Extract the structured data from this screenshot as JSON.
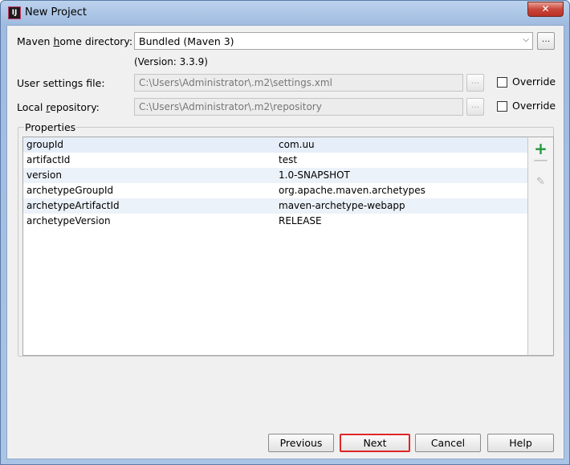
{
  "window": {
    "title": "New Project",
    "app_icon": "intellij-idea-icon",
    "app_icon_text": "IJ",
    "close_glyph": "✕"
  },
  "maven_home": {
    "label_pre": "Maven ",
    "label_mnemonic": "h",
    "label_post": "ome directory:",
    "value": "Bundled (Maven 3)",
    "version_text": "(Version: 3.3.9)",
    "browse_label": "..."
  },
  "user_settings": {
    "label": "User settings file:",
    "value": "C:\\Users\\Administrator\\.m2\\settings.xml",
    "browse_label": "...",
    "override_label": "Override",
    "override_checked": false
  },
  "local_repo": {
    "label_pre": "Local ",
    "label_mnemonic": "r",
    "label_post": "epository:",
    "value": "C:\\Users\\Administrator\\.m2\\repository",
    "browse_label": "...",
    "override_label": "Override",
    "override_checked": false
  },
  "properties": {
    "legend": "Properties",
    "rows": [
      {
        "key": "groupId",
        "value": "com.uu"
      },
      {
        "key": "artifactId",
        "value": "test"
      },
      {
        "key": "version",
        "value": "1.0-SNAPSHOT"
      },
      {
        "key": "archetypeGroupId",
        "value": "org.apache.maven.archetypes"
      },
      {
        "key": "archetypeArtifactId",
        "value": "maven-archetype-webapp"
      },
      {
        "key": "archetypeVersion",
        "value": "RELEASE"
      }
    ],
    "toolbar": {
      "add_glyph": "+",
      "remove_glyph": "—",
      "edit_glyph": "✎"
    }
  },
  "buttons": {
    "previous": "Previous",
    "next": "Next",
    "cancel": "Cancel",
    "help": "Help"
  },
  "colors": {
    "highlight_border": "#e02626",
    "add_icon": "#1f9a3a"
  }
}
